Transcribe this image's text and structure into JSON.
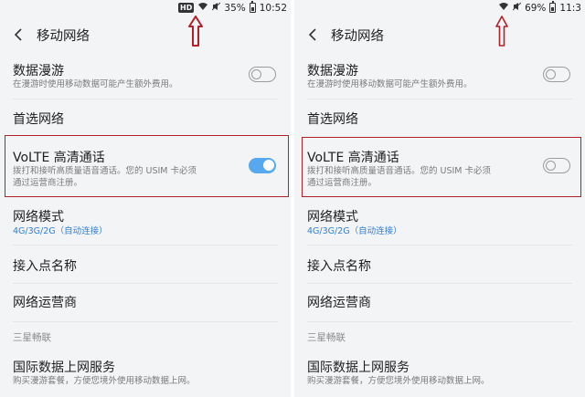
{
  "screens": [
    {
      "status": {
        "hd": "HD",
        "battery": "35%",
        "time": "10:52"
      },
      "title": "移动网络",
      "roaming": {
        "title": "数据漫游",
        "desc": "在漫游时使用移动数据可能产生额外费用。"
      },
      "preferred": {
        "title": "首选网络"
      },
      "volte": {
        "title": "VoLTE 高清通话",
        "desc1": "拨打和接听高质量语音通话。您的 USIM 卡必须",
        "desc2": "通过运营商注册。",
        "enabled": true
      },
      "mode": {
        "title": "网络模式",
        "value": "4G/3G/2G（自动连接）"
      },
      "apn": {
        "title": "接入点名称"
      },
      "operator": {
        "title": "网络运营商"
      },
      "section": "三星畅联",
      "intl": {
        "title": "国际数据上网服务",
        "desc": "购买漫游套餐，方便您境外使用移动数据上网。"
      }
    },
    {
      "status": {
        "battery": "69%",
        "time": "11:3"
      },
      "title": "移动网络",
      "roaming": {
        "title": "数据漫游",
        "desc": "在漫游时使用移动数据可能产生额外费用。"
      },
      "preferred": {
        "title": "首选网络"
      },
      "volte": {
        "title": "VoLTE 高清通话",
        "desc1": "拨打和接听高质量语音通话。您的 USIM 卡必须",
        "desc2": "通过运营商注册。",
        "enabled": false
      },
      "mode": {
        "title": "网络模式",
        "value": "4G/3G/2G（自动连接）"
      },
      "apn": {
        "title": "接入点名称"
      },
      "operator": {
        "title": "网络运营商"
      },
      "section": "三星畅联",
      "intl": {
        "title": "国际数据上网服务",
        "desc": "购买漫游套餐，方便您境外使用移动数据上网。"
      }
    }
  ],
  "colors": {
    "accent": "#2f7fd1",
    "toggle_on": "#56a9ee",
    "highlight": "#b2202a",
    "background": "#f3f4f6"
  },
  "icons": [
    "back-arrow-icon",
    "wifi-icon",
    "signal-icon",
    "battery-icon",
    "mute-icon",
    "red-up-arrow-icon"
  ]
}
